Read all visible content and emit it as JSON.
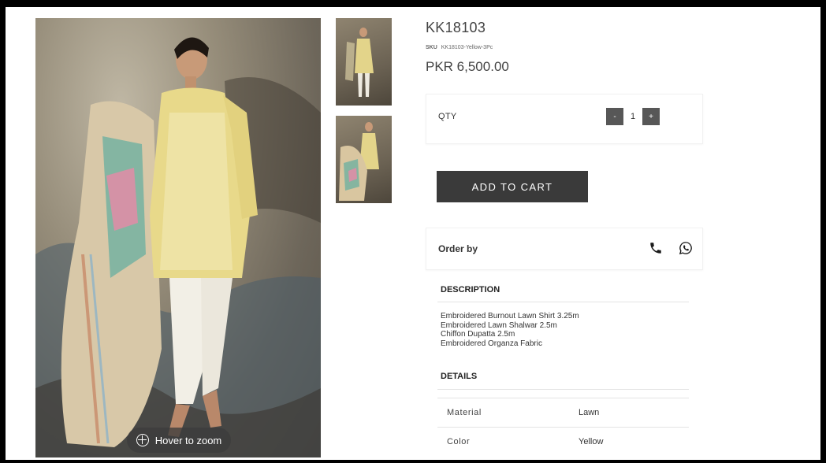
{
  "product": {
    "title": "KK18103",
    "sku_label": "SKU",
    "sku_value": "KK18103-Yellow-3Pc",
    "price": "PKR 6,500.00"
  },
  "gallery": {
    "zoom_hint": "Hover to zoom",
    "zoom_icon": "plus-circle-icon"
  },
  "quantity": {
    "label": "QTY",
    "decrement": "-",
    "value": "1",
    "increment": "+"
  },
  "cart": {
    "add_label": "ADD TO CART"
  },
  "order": {
    "label": "Order by",
    "icons": [
      "phone-icon",
      "whatsapp-icon"
    ]
  },
  "description": {
    "heading": "DESCRIPTION",
    "lines": [
      "Embroidered Burnout Lawn Shirt 3.25m",
      "Embroidered Lawn Shalwar 2.5m",
      "Chiffon Dupatta 2.5m",
      "Embroidered Organza Fabric"
    ]
  },
  "details": {
    "heading": "DETAILS",
    "rows": [
      {
        "key": "Material",
        "value": "Lawn"
      },
      {
        "key": "Color",
        "value": "Yellow"
      }
    ]
  },
  "colors": {
    "button_dark": "#3a3a3a",
    "stepper": "#575757"
  }
}
